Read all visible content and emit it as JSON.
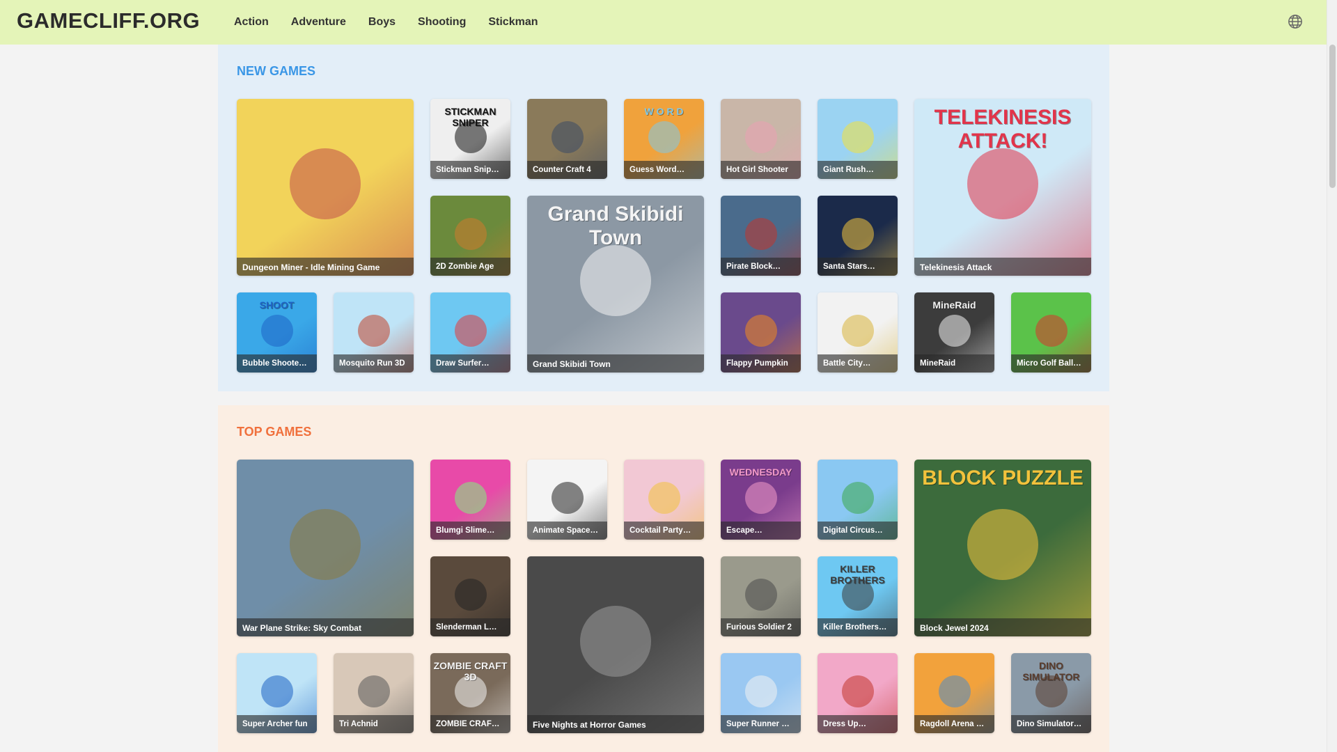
{
  "site": {
    "logo": "GAMECLIFF.ORG"
  },
  "nav": [
    "Action",
    "Adventure",
    "Boys",
    "Shooting",
    "Stickman"
  ],
  "sections": {
    "new": {
      "title": "NEW GAMES",
      "games": [
        {
          "name": "Dungeon Miner - Idle Mining Game",
          "big": true,
          "bg": "#f2d35a",
          "accent": "#c2504a"
        },
        {
          "name": "Stickman Snip…",
          "bg": "#efefef",
          "accent": "#111111",
          "art": "STICKMAN SNIPER"
        },
        {
          "name": "Counter Craft 4",
          "bg": "#8a7a5a",
          "accent": "#3b4a66"
        },
        {
          "name": "Guess Word…",
          "bg": "#f0a23c",
          "accent": "#7ec8e8",
          "art": "W O R D"
        },
        {
          "name": "Hot Girl Shooter",
          "bg": "#c9b6a8",
          "accent": "#e9a1b2"
        },
        {
          "name": "Giant Rush…",
          "bg": "#9bd3f2",
          "accent": "#f2e23c"
        },
        {
          "name": "Telekinesis Attack",
          "big": true,
          "bg": "#cfe9f7",
          "accent": "#e2344a",
          "art": "TELEKINESIS ATTACK!"
        },
        {
          "name": "2D Zombie Age",
          "bg": "#6b8a3c",
          "accent": "#d07a2c"
        },
        {
          "name": "Grand Skibidi Town",
          "big": true,
          "bg": "#8c98a4",
          "accent": "#f4f4f4",
          "art": "Grand Skibidi Town"
        },
        {
          "name": "Pirate Block…",
          "bg": "#4a6b8c",
          "accent": "#c2342c"
        },
        {
          "name": "Santa Stars…",
          "bg": "#1b2a4a",
          "accent": "#f2c23c"
        },
        {
          "name": "Bubble Shoote…",
          "bg": "#3aa8e8",
          "accent": "#1e63c4",
          "art": "SHOOT"
        },
        {
          "name": "Mosquito Run 3D",
          "bg": "#bfe4f7",
          "accent": "#c2442c"
        },
        {
          "name": "Draw Surfer…",
          "bg": "#6ec8f2",
          "accent": "#e83a3a"
        },
        {
          "name": "Flappy Pumpkin",
          "bg": "#6a4a8c",
          "accent": "#f28a1c"
        },
        {
          "name": "Battle City…",
          "bg": "#f2f2f2",
          "accent": "#d8b43c"
        },
        {
          "name": "MineRaid",
          "bg": "#3c3c3c",
          "accent": "#f2f2f2",
          "art": "MineRaid"
        },
        {
          "name": "Micro Golf Ball…",
          "bg": "#5bc24a",
          "accent": "#d8342c"
        }
      ]
    },
    "top": {
      "title": "TOP GAMES",
      "games": [
        {
          "name": "War Plane Strike: Sky Combat",
          "big": true,
          "bg": "#6f8ea8",
          "accent": "#8a7a3c"
        },
        {
          "name": "Blumgi Slime…",
          "bg": "#e84aa8",
          "accent": "#7ef27e"
        },
        {
          "name": "Animate Space…",
          "bg": "#f4f4f4",
          "accent": "#222222"
        },
        {
          "name": "Cocktail Party…",
          "bg": "#f2c8d4",
          "accent": "#f2c23c"
        },
        {
          "name": "Escape…",
          "bg": "#7a3c8c",
          "accent": "#f29ac8",
          "art": "WEDNESDAY"
        },
        {
          "name": "Digital Circus…",
          "bg": "#8ac8f2",
          "accent": "#3ca84a"
        },
        {
          "name": "Block Jewel 2024",
          "big": true,
          "bg": "#3c6b3c",
          "accent": "#f2c23c",
          "art": "BLOCK PUZZLE"
        },
        {
          "name": "Slenderman L…",
          "bg": "#5a4a3c",
          "accent": "#222222"
        },
        {
          "name": "Five Nights at Horror Games",
          "big": true,
          "bg": "#4a4a4a",
          "accent": "#9a9a9a"
        },
        {
          "name": "Furious Soldier 2",
          "bg": "#9a9a8c",
          "accent": "#4a4a4a"
        },
        {
          "name": "Killer Brothers…",
          "bg": "#6ec8f2",
          "accent": "#3c3c3c",
          "art": "KILLER BROTHERS"
        },
        {
          "name": "Super Archer fun",
          "bg": "#bfe4f7",
          "accent": "#1e63c4"
        },
        {
          "name": "Tri Achnid",
          "bg": "#d8c8b8",
          "accent": "#5a5a5a"
        },
        {
          "name": "ZOMBIE CRAF…",
          "bg": "#7a6a5a",
          "accent": "#f4f4f4",
          "art": "ZOMBIE CRAFT 3D"
        },
        {
          "name": "Super Runner …",
          "bg": "#9ac8f2",
          "accent": "#f2f2f2"
        },
        {
          "name": "Dress Up…",
          "bg": "#f2a8c8",
          "accent": "#c2342c"
        },
        {
          "name": "Ragdoll Arena …",
          "bg": "#f2a23c",
          "accent": "#4a8ac8"
        },
        {
          "name": "Dino Simulator…",
          "bg": "#8a9aa8",
          "accent": "#5a3c2c",
          "art": "DINO SIMULATOR"
        }
      ]
    }
  }
}
